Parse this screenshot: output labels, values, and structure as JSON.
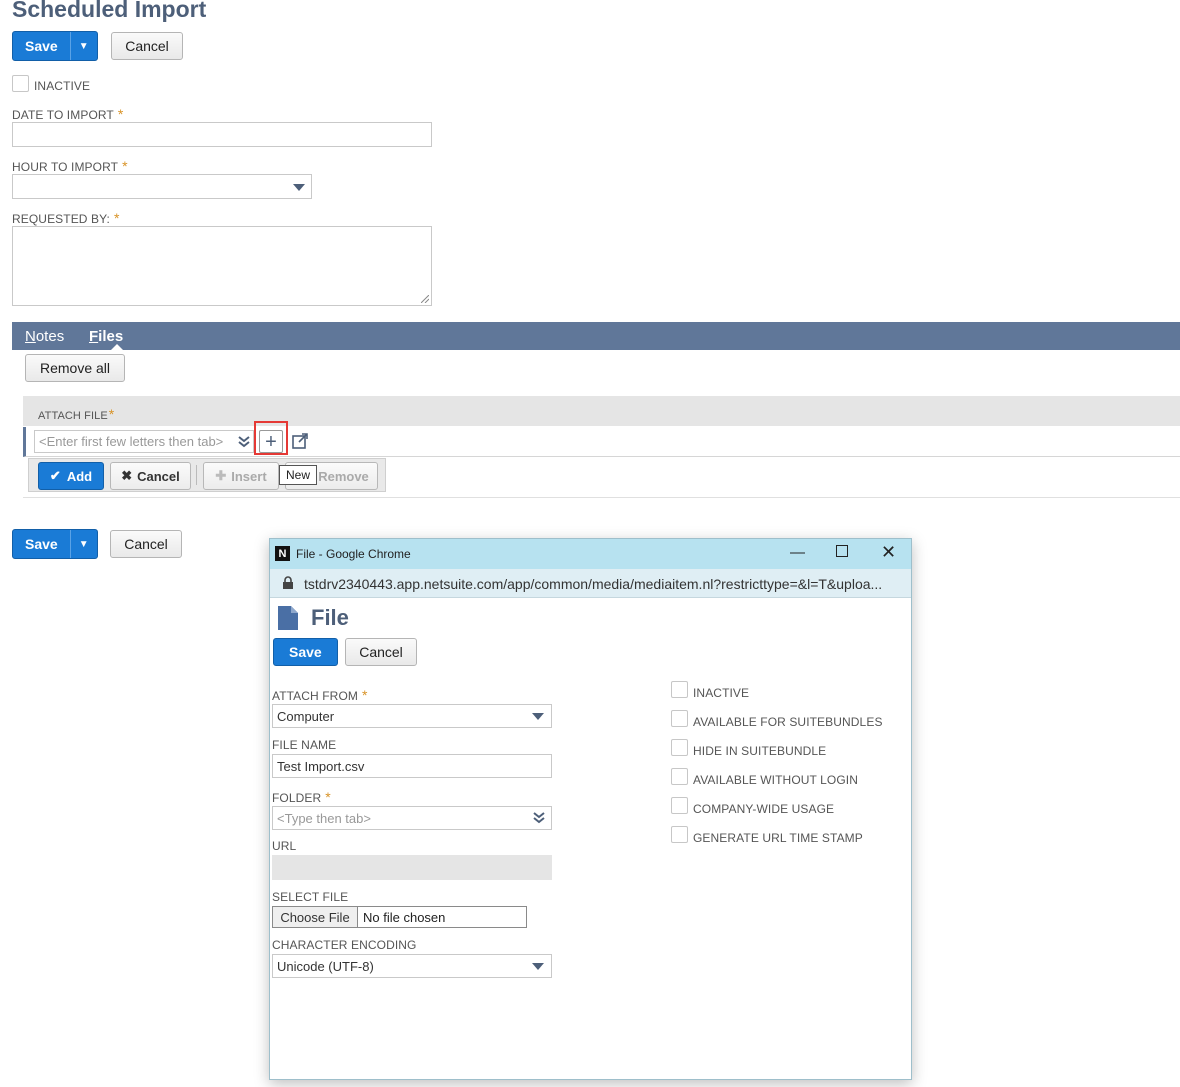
{
  "page": {
    "title": "Scheduled Import",
    "save_label": "Save",
    "cancel_label": "Cancel",
    "inactive_label": "INACTIVE",
    "fields": {
      "date_label": "DATE TO IMPORT",
      "hour_label": "HOUR TO IMPORT",
      "requested_label": "REQUESTED BY:",
      "required_mark": "*"
    }
  },
  "tabs": [
    {
      "label": "Notes",
      "underline": "N",
      "rest": "otes"
    },
    {
      "label": "Files",
      "underline": "F",
      "rest": "iles"
    }
  ],
  "files": {
    "remove_all_label": "Remove all",
    "attach_label": "ATTACH FILE",
    "attach_placeholder": "<Enter first few letters then tab>",
    "tooltip": "New",
    "buttons": {
      "add": "Add",
      "cancel": "Cancel",
      "insert": "Insert",
      "remove": "Remove"
    }
  },
  "popup": {
    "window_title": "File - Google Chrome",
    "url": "tstdrv2340443.app.netsuite.com/app/common/media/mediaitem.nl?restricttype=&l=T&uploa...",
    "heading": "File",
    "save_label": "Save",
    "cancel_label": "Cancel",
    "attach_from_label": "ATTACH FROM",
    "attach_from_value": "Computer",
    "file_name_label": "FILE NAME",
    "file_name_value": "Test Import.csv",
    "folder_label": "FOLDER",
    "folder_placeholder": "<Type then tab>",
    "url_label": "URL",
    "select_file_label": "SELECT FILE",
    "choose_file_label": "Choose File",
    "no_file_label": "No file chosen",
    "encoding_label": "CHARACTER ENCODING",
    "encoding_value": "Unicode (UTF-8)",
    "checkboxes": [
      "INACTIVE",
      "AVAILABLE FOR SUITEBUNDLES",
      "HIDE IN SUITEBUNDLE",
      "AVAILABLE WITHOUT LOGIN",
      "COMPANY-WIDE USAGE",
      "GENERATE URL TIME STAMP"
    ]
  },
  "colors": {
    "accent_blue": "#1a7bd6",
    "tab_bar": "#607799",
    "title": "#4d5f79",
    "required": "#d89327",
    "highlight": "#e53935"
  }
}
